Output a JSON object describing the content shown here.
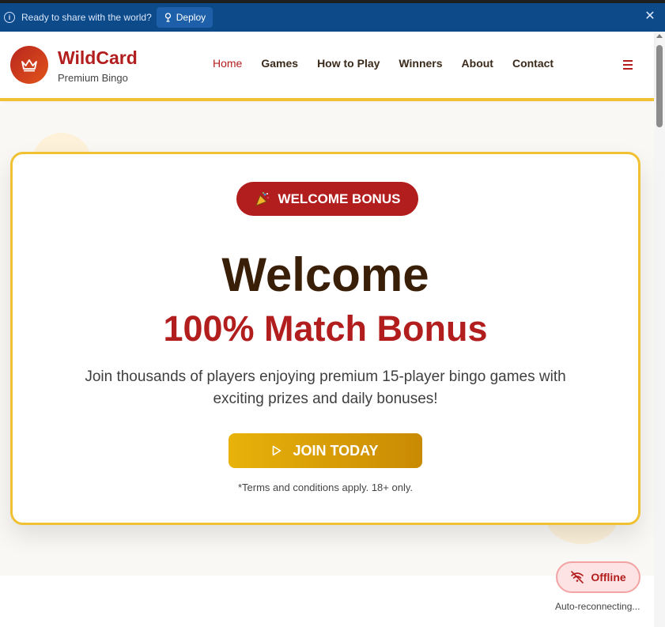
{
  "notice": {
    "message": "Ready to share with the world?",
    "deploy_label": "Deploy"
  },
  "header": {
    "brand_name": "WildCard",
    "brand_subtitle": "Premium Bingo",
    "nav": [
      "Home",
      "Games",
      "How to Play",
      "Winners",
      "About",
      "Contact"
    ],
    "active_nav": "Home"
  },
  "hero": {
    "badge_label": "WELCOME BONUS",
    "title_line1": "Welcome",
    "title_line2": "100% Match Bonus",
    "description": "Join thousands of players enjoying premium 15-player bingo games with exciting prizes and daily bonuses!",
    "cta_label": "JOIN TODAY",
    "terms": "*Terms and conditions apply. 18+ only."
  },
  "status": {
    "offline_label": "Offline",
    "reconnect_text": "Auto-reconnecting..."
  },
  "colors": {
    "brand_red": "#b21e1e",
    "gold": "#f0c233",
    "notice_blue": "#0c4a8a"
  },
  "icons": {
    "info": "info-icon",
    "deploy": "deploy-icon",
    "close": "close-icon",
    "logo": "crown-icon",
    "menu": "hamburger-icon",
    "badge": "party-popper-icon",
    "cta": "play-icon",
    "offline": "wifi-off-icon"
  }
}
